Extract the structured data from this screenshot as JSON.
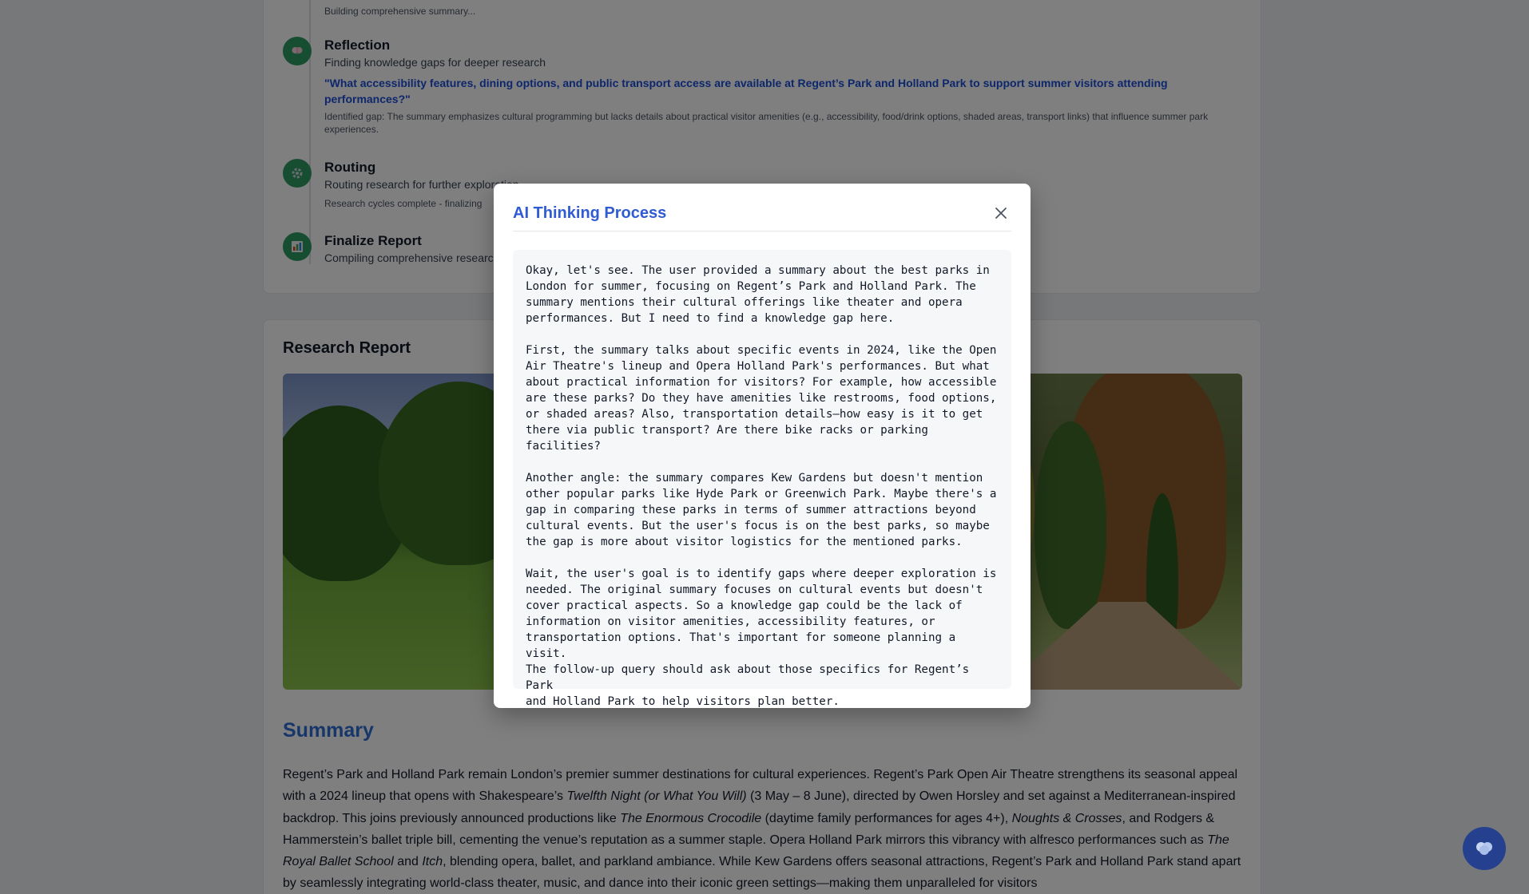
{
  "steps": [
    {
      "title": "",
      "subtitle": "",
      "note": "Building comprehensive summary..."
    },
    {
      "title": "Reflection",
      "subtitle": "Finding knowledge gaps for deeper research",
      "query": "\"What accessibility features, dining options, and public transport access are available at Regent’s Park and Holland Park to support summer visitors attending performances?\"",
      "note": "Identified gap: The summary emphasizes cultural programming but lacks details about practical visitor amenities (e.g., accessibility, food/drink options, shaded areas, transport links) that influence summer park experiences."
    },
    {
      "title": "Routing",
      "subtitle": "Routing research for further exploration",
      "note": "Research cycles complete - finalizing"
    },
    {
      "title": "Finalize Report",
      "subtitle": "Compiling comprehensive research"
    }
  ],
  "report": {
    "title": "Research Report",
    "summary_heading": "Summary",
    "summary_parts": {
      "p1": "Regent’s Park and Holland Park remain London’s premier summer destinations for cultural experiences. Regent’s Park Open Air Theatre strengthens its seasonal appeal with a 2024 lineup that opens with Shakespeare’s ",
      "i1": "Twelfth Night (or What You Will)",
      "p2": " (3 May – 8 June), directed by Owen Horsley and set against a Mediterranean-inspired backdrop. This joins previously announced productions like ",
      "i2": "The Enormous Crocodile",
      "p3": " (daytime family performances for ages 4+), ",
      "i3": "Noughts & Crosses",
      "p4": ", and Rodgers & Hammerstein’s ballet triple bill, cementing the venue’s reputation as a summer staple. Opera Holland Park mirrors this vibrancy with alfresco performances such as ",
      "i4": "The Royal Ballet School",
      "p5": " and ",
      "i5": "Itch",
      "p6": ", blending opera, ballet, and parkland ambiance. While Kew Gardens offers seasonal attractions, Regent’s Park and Holland Park stand apart by seamlessly integrating world-class theater, music, and dance into their iconic green settings—making them unparalleled for visitors"
    }
  },
  "modal": {
    "title": "AI Thinking Process",
    "content": "Okay, let's see. The user provided a summary about the best parks in\nLondon for summer, focusing on Regent’s Park and Holland Park. The\nsummary mentions their cultural offerings like theater and opera\nperformances. But I need to find a knowledge gap here.\n\nFirst, the summary talks about specific events in 2024, like the Open\nAir Theatre's lineup and Opera Holland Park's performances. But what\nabout practical information for visitors? For example, how accessible\nare these parks? Do they have amenities like restrooms, food options,\nor shaded areas? Also, transportation details—how easy is it to get\nthere via public transport? Are there bike racks or parking\nfacilities?\n\nAnother angle: the summary compares Kew Gardens but doesn't mention\nother popular parks like Hyde Park or Greenwich Park. Maybe there's a\ngap in comparing these parks in terms of summer attractions beyond\ncultural events. But the user's focus is on the best parks, so maybe\nthe gap is more about visitor logistics for the mentioned parks.\n\nWait, the user's goal is to identify gaps where deeper exploration is\nneeded. The original summary focuses on cultural events but doesn't\ncover practical aspects. So a knowledge gap could be the lack of\ninformation on visitor amenities, accessibility features, or\ntransportation options. That's important for someone planning a visit.\nThe follow-up query should ask about those specifics for Regent’s Park\nand Holland Park to help visitors plan better."
  },
  "icons": {
    "reflection": "brain-icon",
    "routing": "gear-icon",
    "finalize": "chart-icon",
    "close": "close-icon",
    "chat": "chat-icon"
  },
  "colors": {
    "accent": "#2f5bd3",
    "step_icon_bg": "#2f9a62",
    "query_link": "#1d4ed8",
    "fab_bg": "#24408f"
  }
}
